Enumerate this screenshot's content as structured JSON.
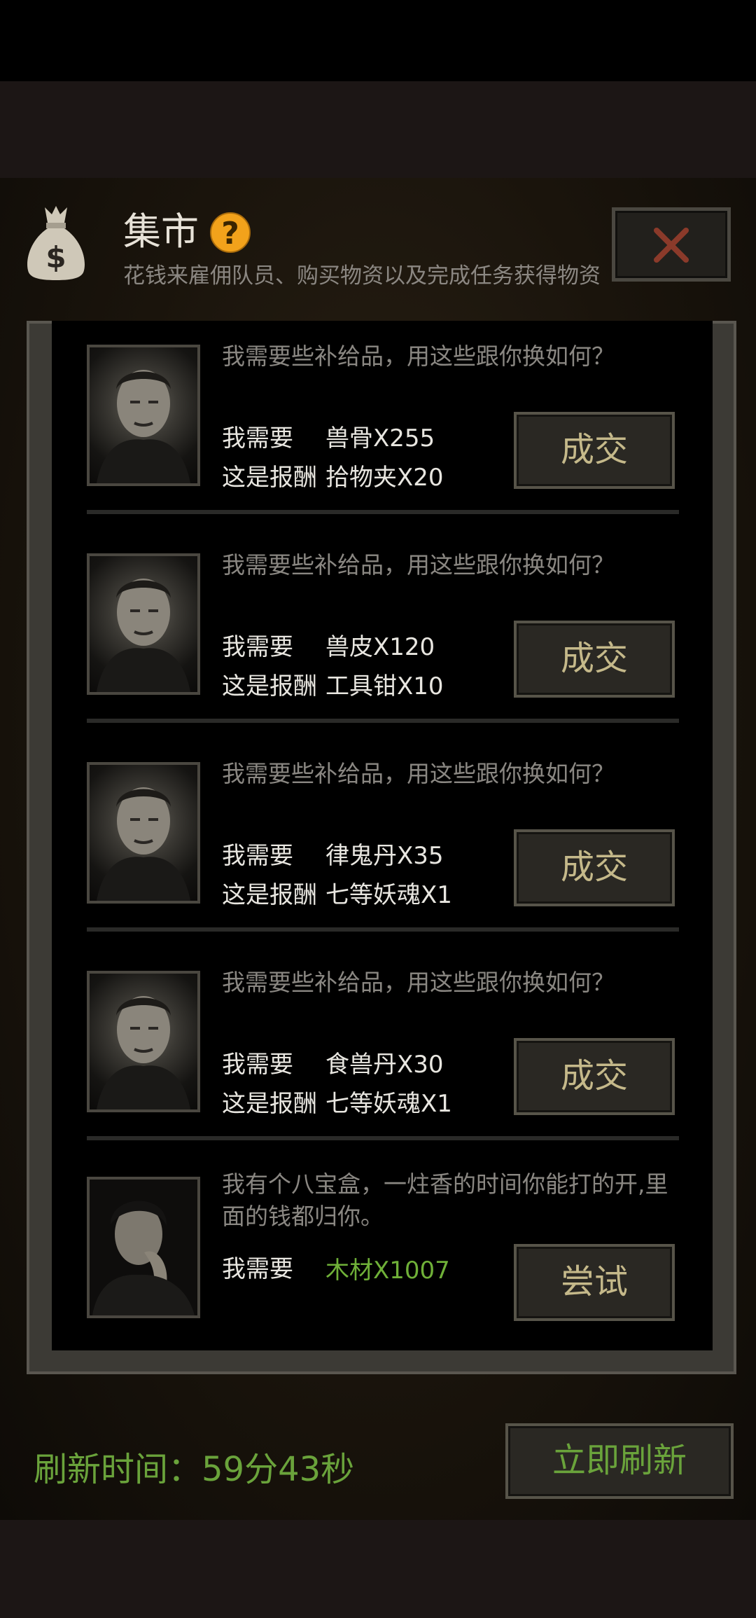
{
  "header": {
    "title": "集市",
    "help_symbol": "?",
    "subtitle": "花钱来雇佣队员、购买物资以及完成任务获得物资",
    "close_icon": "close-icon",
    "bag_icon": "money-bag-icon"
  },
  "offers": [
    {
      "prompt": "我需要些补给品，用这些跟你换如何？",
      "need_label": "我需要",
      "need_value": "兽骨X255",
      "reward_label": "这是报酬",
      "reward_value": "拾物夹X20",
      "button": "成交"
    },
    {
      "prompt": "我需要些补给品，用这些跟你换如何？",
      "need_label": "我需要",
      "need_value": "兽皮X120",
      "reward_label": "这是报酬",
      "reward_value": "工具钳X10",
      "button": "成交"
    },
    {
      "prompt": "我需要些补给品，用这些跟你换如何？",
      "need_label": "我需要",
      "need_value": "律鬼丹X35",
      "reward_label": "这是报酬",
      "reward_value": "七等妖魂X1",
      "button": "成交"
    },
    {
      "prompt": "我需要些补给品，用这些跟你换如何？",
      "need_label": "我需要",
      "need_value": "食兽丹X30",
      "reward_label": "这是报酬",
      "reward_value": "七等妖魂X1",
      "button": "成交"
    },
    {
      "prompt": "我有个八宝盒，一炷香的时间你能打的开,里面的钱都归你。",
      "need_label": "我需要",
      "need_value": "木材X1007",
      "button": "尝试"
    }
  ],
  "footer": {
    "refresh_time": "刷新时间：59分43秒",
    "refresh_button": "立即刷新"
  },
  "colors": {
    "accent_green": "#6aa33b",
    "button_text": "#c5b98a",
    "help_orange": "#f2a21b",
    "close_red": "#8b3a2a"
  }
}
